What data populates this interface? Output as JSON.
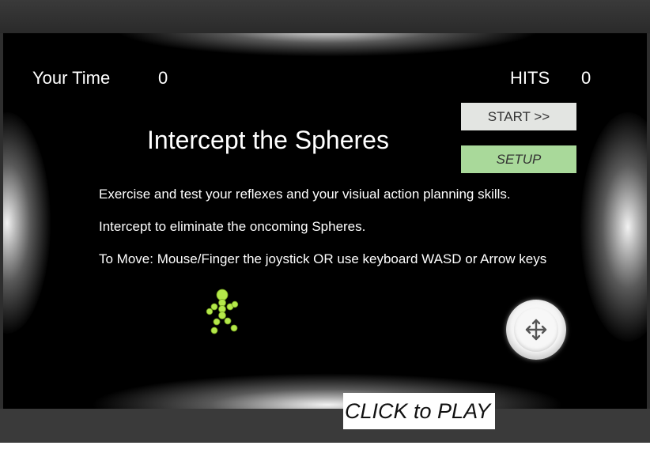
{
  "hud": {
    "time_label": "Your Time",
    "time_value": "0",
    "hits_label": "HITS",
    "hits_value": "0"
  },
  "title": "Intercept the Spheres",
  "description": [
    "Exercise and test your reflexes and your visiual action planning skills.",
    "Intercept to eliminate the oncoming Spheres.",
    "To Move: Mouse/Finger the joystick OR use keyboard WASD or Arrow keys"
  ],
  "buttons": {
    "start_label": "START >>",
    "setup_label": "SETUP",
    "play_label": "CLICK to PLAY"
  },
  "icons": {
    "player": "stick-figure-icon",
    "joystick": "move-arrows-icon"
  },
  "colors": {
    "stage": "#000000",
    "start_button": "#e3e5e2",
    "setup_button": "#a9d99a",
    "player": "#b4e84a"
  }
}
